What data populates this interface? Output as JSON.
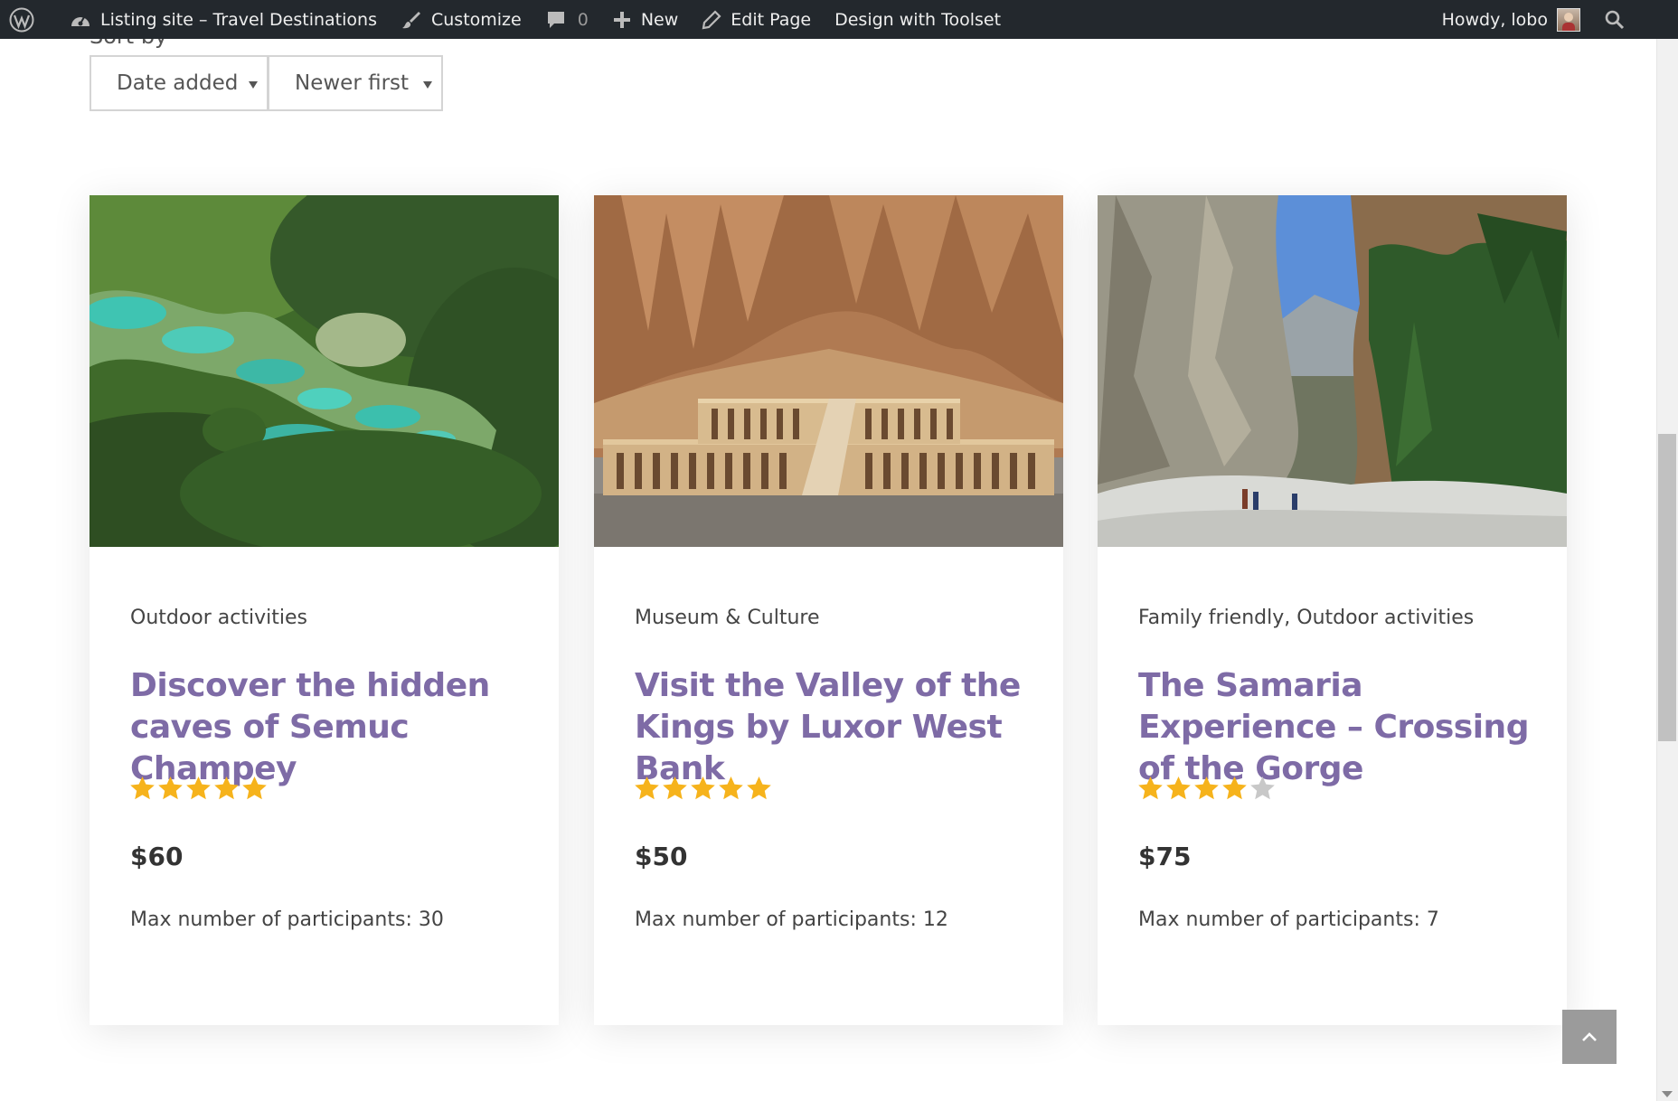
{
  "adminbar": {
    "site_title": "Listing site – Travel Destinations",
    "customize": "Customize",
    "comments_count": "0",
    "new": "New",
    "edit_page": "Edit Page",
    "design_toolset": "Design with Toolset",
    "howdy": "Howdy, lobo"
  },
  "sort": {
    "label": "Sort by",
    "field": "Date added",
    "order": "Newer first"
  },
  "cards": [
    {
      "category": "Outdoor activities",
      "title": "Discover the hidden caves of Semuc Champey",
      "rating": 5,
      "price": "$60",
      "participants": "Max number of participants: 30"
    },
    {
      "category": "Museum & Culture",
      "title": "Visit the Valley of the Kings by Luxor West Bank",
      "rating": 5,
      "price": "$50",
      "participants": "Max number of participants: 12"
    },
    {
      "category": "Family friendly, Outdoor activities",
      "title": "The Samaria Experience – Crossing of the Gorge",
      "rating": 4,
      "price": "$75",
      "participants": "Max number of participants: 7"
    }
  ],
  "colors": {
    "title": "#7e6ba6",
    "star_filled": "#f6b31c",
    "star_empty": "#c8c8c8",
    "adminbar": "#23282d"
  }
}
